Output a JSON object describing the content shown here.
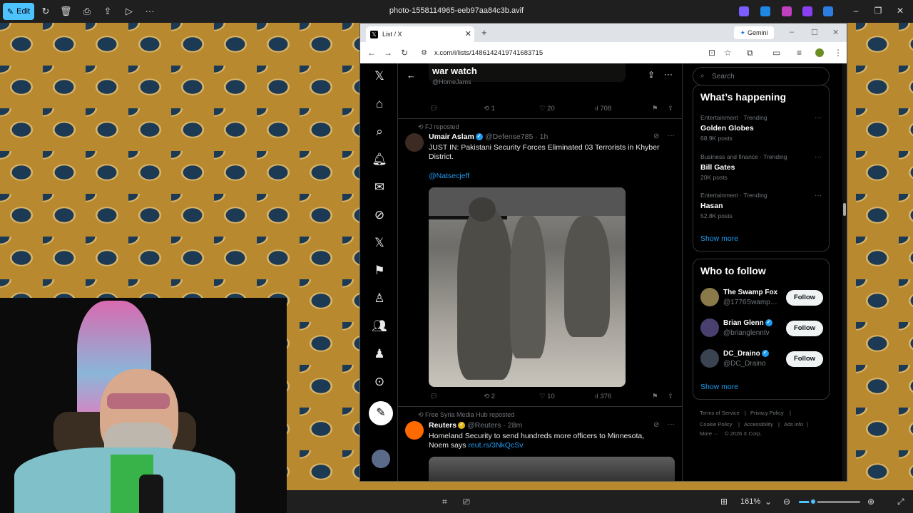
{
  "viewer": {
    "edit_label": "Edit",
    "file_title": "photo-1558114965-eeb97aa84c3b.avif",
    "zoom": "161%",
    "zoom_level": 0.23
  },
  "browser": {
    "tab_title": "List / X",
    "gemini_label": "Gemini",
    "url": "x.com/i/lists/1486142419741683715"
  },
  "list": {
    "title": "war watch",
    "handle": "@HomeJams"
  },
  "posts": [
    {
      "actions": {
        "replies": "",
        "reposts": "1",
        "likes": "20",
        "views": "708"
      }
    },
    {
      "context": "FJ reposted",
      "name": "Umair Aslam",
      "handle": "@Defense785",
      "time": "· 1h",
      "text": "JUST IN: Pakistani Security Forces Eliminated 03 Terrorists in Khyber District.",
      "mention": "@Natsecjeff",
      "actions": {
        "replies": "",
        "reposts": "2",
        "likes": "10",
        "views": "376"
      }
    },
    {
      "context": "Free Syria Media Hub reposted",
      "name": "Reuters",
      "handle": "@Reuters",
      "time": "· 28m",
      "text": "Homeland Security to send hundreds more officers to Minnesota, Noem says",
      "link": "reut.rs/3NkQcSv"
    }
  ],
  "sidebar": {
    "search_placeholder": "Search",
    "happening_title": "What’s happening",
    "trends": [
      {
        "category": "Entertainment · Trending",
        "name": "Golden Globes",
        "posts": "68.9K posts"
      },
      {
        "category": "Business and finance · Trending",
        "name": "Bill Gates",
        "posts": "20K posts"
      },
      {
        "category": "Entertainment · Trending",
        "name": "Hasan",
        "posts": "52.8K posts"
      }
    ],
    "show_more": "Show more",
    "follow_title": "Who to follow",
    "follow": [
      {
        "name": "The Swamp Fox",
        "handle": "@1776Swamp_...",
        "button": "Follow"
      },
      {
        "name": "Brian Glenn",
        "handle": "@brianglenntv",
        "button": "Follow"
      },
      {
        "name": "DC_Draino",
        "handle": "@DC_Draino",
        "button": "Follow"
      }
    ],
    "footer": {
      "terms": "Terms of Service",
      "privacy": "Privacy Policy",
      "cookie": "Cookie Policy",
      "accessibility": "Accessibility",
      "ads": "Ads info",
      "more": "More ···",
      "copyright": "© 2026 X Corp."
    }
  },
  "colors": {
    "accent": "#1d9bf0",
    "viewer_accent": "#4cc2ff",
    "verified_gold": "#e2b719"
  }
}
